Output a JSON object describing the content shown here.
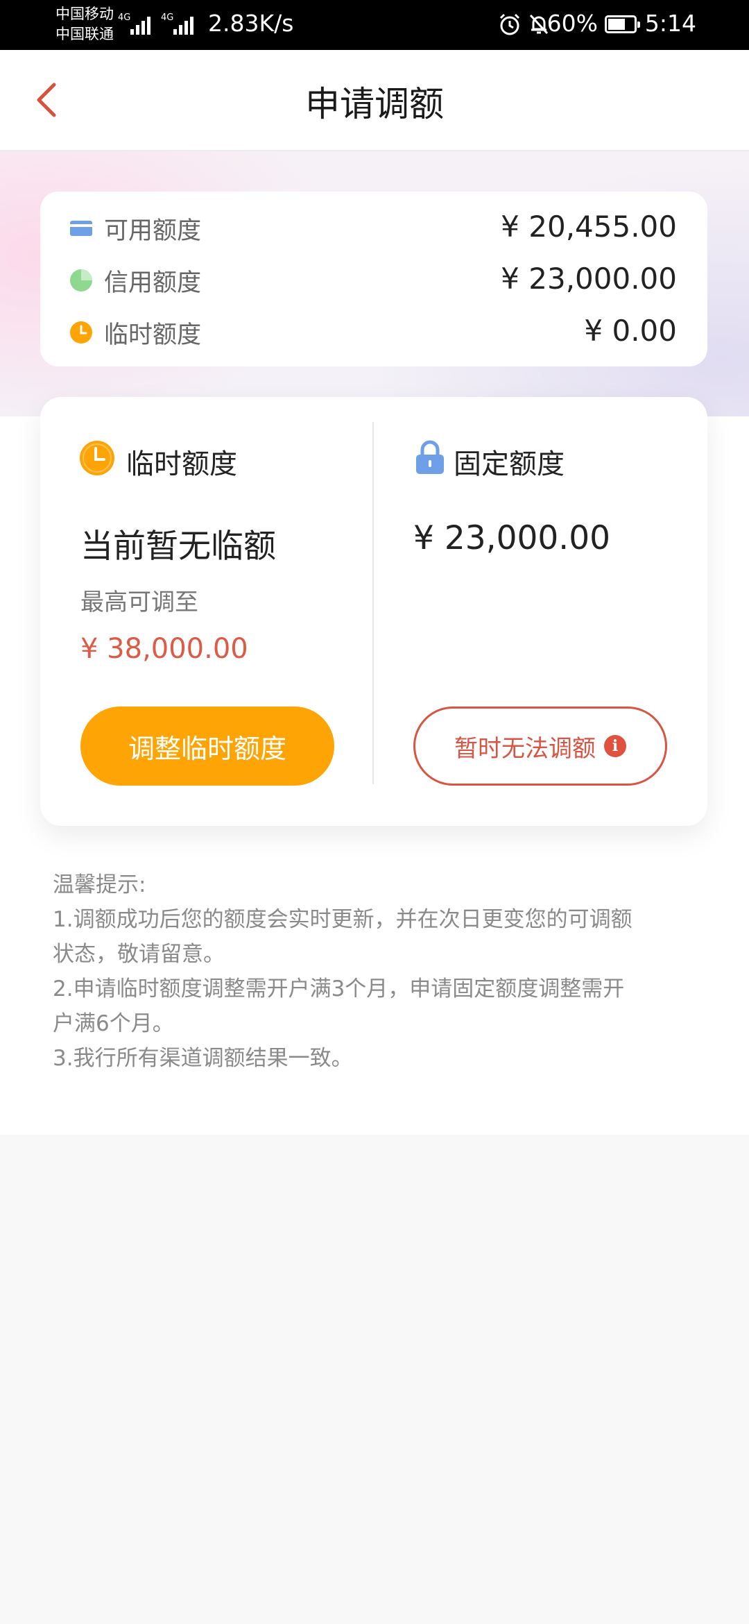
{
  "status_bar": {
    "carrier_1": "中国移动",
    "carrier_2": "中国联通",
    "net_1": "4G",
    "net_2": "4G",
    "speed": "2.83K/s",
    "battery": "60%",
    "time": "5:14"
  },
  "header": {
    "title": "申请调额"
  },
  "summary": {
    "rows": [
      {
        "label": "可用额度",
        "value": "¥ 20,455.00",
        "icon": "card-icon"
      },
      {
        "label": "信用额度",
        "value": "¥ 23,000.00",
        "icon": "pie-icon"
      },
      {
        "label": "临时额度",
        "value": "¥ 0.00",
        "icon": "clock-icon"
      }
    ]
  },
  "temporary": {
    "title": "临时额度",
    "current": "当前暂无临额",
    "max_label": "最高可调至",
    "max_value": "¥ 38,000.00",
    "button": "调整临时额度"
  },
  "fixed": {
    "title": "固定额度",
    "amount": "¥ 23,000.00",
    "button": "暂时无法调额",
    "info_glyph": "i"
  },
  "tips": {
    "title": "温馨提示:",
    "lines": [
      "1.调额成功后您的额度会实时更新，并在次日更变您的可调额",
      "状态，敬请留意。",
      "2.申请临时额度调整需开户满3个月，申请固定额度调整需开",
      "户满6个月。",
      "3.我行所有渠道调额结果一致。"
    ]
  },
  "colors": {
    "accent_orange": "#ffa405",
    "accent_red": "#d95443",
    "card_blue": "#6f9fe6",
    "pie_green": "#8fd88f"
  }
}
